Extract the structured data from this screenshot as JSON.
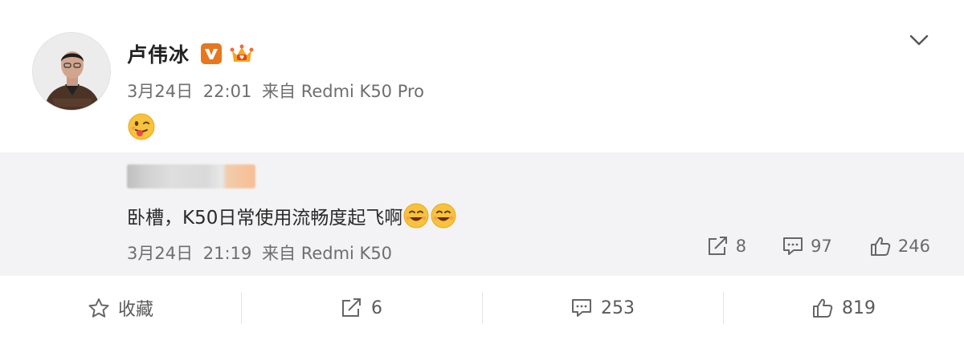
{
  "post": {
    "author": "卢伟冰",
    "date": "3月24日",
    "time": "22:01",
    "from_prefix": "来自",
    "source": "Redmi K50 Pro",
    "content_emoji": "tongue-out-emoji"
  },
  "repost": {
    "text": "卧槽，K50日常使用流畅度起飞啊",
    "date": "3月24日",
    "time": "21:19",
    "from_prefix": "来自",
    "source": "Redmi K50",
    "shares": "8",
    "comments": "97",
    "likes": "246"
  },
  "actions": {
    "favorite_label": "收藏",
    "shares": "6",
    "comments": "253",
    "likes": "819"
  },
  "colors": {
    "verified_badge": "#e8761f",
    "meta_text": "#6e6e6e",
    "repost_bg": "#f3f3f5"
  }
}
